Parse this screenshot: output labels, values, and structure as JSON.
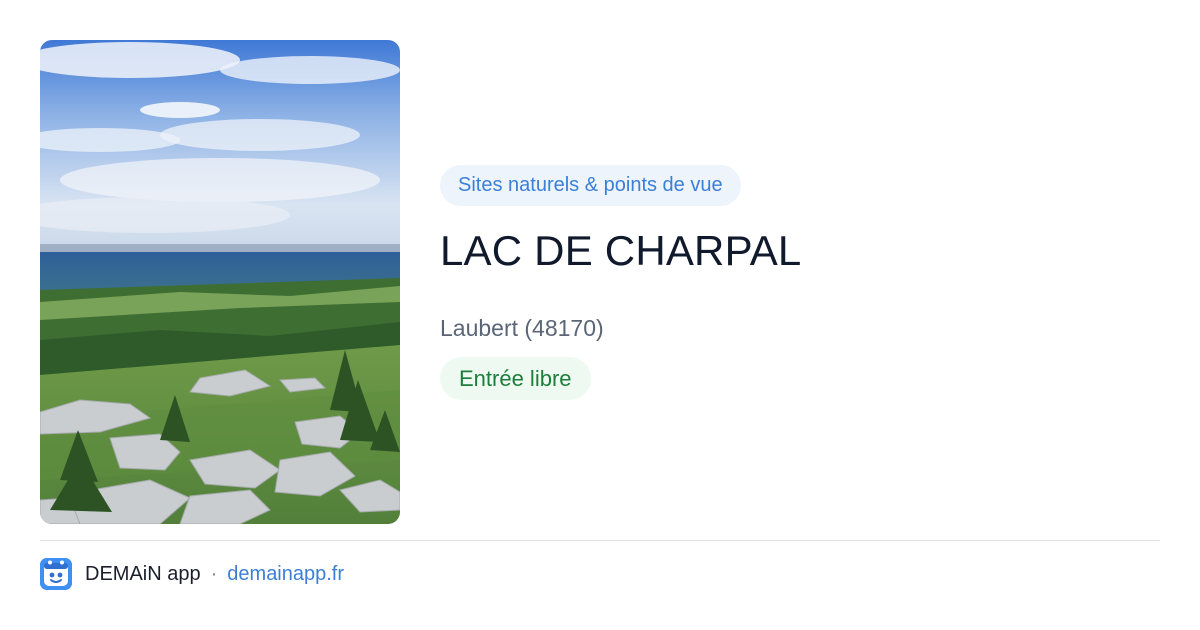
{
  "photo": {
    "subject": "landscape-photo"
  },
  "place": {
    "category": "Sites naturels & points de vue",
    "title": "LAC DE CHARPAL",
    "location": "Laubert (48170)",
    "access": "Entrée libre"
  },
  "footer": {
    "app_name": "DEMAiN app",
    "separator": "·",
    "url": "demainapp.fr"
  },
  "colors": {
    "accent": "#3b7fd6",
    "category_pill_bg": "#eef4fc",
    "access_text": "#1e7d3c",
    "access_pill_bg": "#eefaf1",
    "title_text": "#111a2c"
  }
}
